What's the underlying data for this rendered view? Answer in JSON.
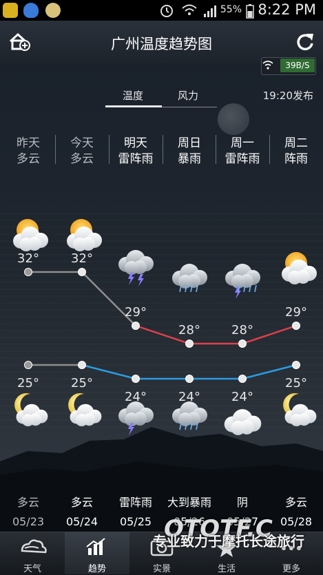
{
  "status": {
    "battery_pct": "55%",
    "time": "8:22 PM"
  },
  "header": {
    "title": "广州温度趋势图",
    "speed": "39B/S"
  },
  "tabs": [
    {
      "label": "温度"
    },
    {
      "label": "风力"
    }
  ],
  "publish_time": "19:20发布",
  "days": [
    {
      "name": "昨天",
      "weather": "多云",
      "high": "32°",
      "low": "25°",
      "night_weather": "多云",
      "date": "05/23"
    },
    {
      "name": "今天",
      "weather": "多云",
      "high": "32°",
      "low": "25°",
      "night_weather": "多云",
      "date": "05/24"
    },
    {
      "name": "明天",
      "weather": "雷阵雨",
      "high": "29°",
      "low": "24°",
      "night_weather": "雷阵雨",
      "date": "05/25"
    },
    {
      "name": "周日",
      "weather": "暴雨",
      "high": "28°",
      "low": "24°",
      "night_weather": "大到暴雨",
      "date": "05/26"
    },
    {
      "name": "周一",
      "weather": "雷阵雨",
      "high": "28°",
      "low": "24°",
      "night_weather": "阴",
      "date": "05/27"
    },
    {
      "name": "周二",
      "weather": "阵雨",
      "high": "29°",
      "low": "25°",
      "night_weather": "多云",
      "date": "05/28"
    }
  ],
  "high_values": [
    32,
    32,
    29,
    28,
    28,
    29
  ],
  "low_values": [
    25,
    25,
    24,
    24,
    24,
    25
  ],
  "colors": {
    "past_line": "#8f8f8f",
    "high_line": "#e0404a",
    "low_line": "#2a9de0",
    "accent_green": "#2f6b33"
  },
  "nav": [
    {
      "label": "天气",
      "icon": "cloud-swirl-icon"
    },
    {
      "label": "趋势",
      "icon": "bar-chart-icon"
    },
    {
      "label": "实景",
      "icon": "camera-icon"
    },
    {
      "label": "生活",
      "icon": "star-icon"
    },
    {
      "label": "更多",
      "icon": "more-icon"
    }
  ],
  "watermark": {
    "logo": "OTOTF.C",
    "text": "专业致力于摩托长途旅行"
  }
}
